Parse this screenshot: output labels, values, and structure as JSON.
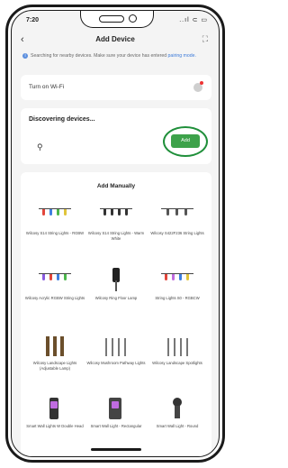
{
  "status_bar": {
    "time": "7:20",
    "signal": "..ıl ⊂ ▭"
  },
  "header": {
    "back_icon": "chevron-left-icon",
    "title": "Add Device",
    "scan_icon": "scan-icon"
  },
  "hint": {
    "text": "Searching for nearby devices. Make sure your device has entered ",
    "link": "pairing mode."
  },
  "wifi": {
    "label": "Turn on Wi-Fi"
  },
  "discovering": {
    "label": "Discovering devices...",
    "add_label": "Add"
  },
  "manual": {
    "heading": "Add Manually",
    "items": [
      {
        "name": "Wilcosy S14 String Lights - RGBW",
        "icon": "string-lights-rgbw"
      },
      {
        "name": "Wilcosy S14 String Lights - Warm White",
        "icon": "string-lights-warm"
      },
      {
        "name": "Wilcosy S422F236 String Lights",
        "icon": "string-lights-small"
      },
      {
        "name": "Wilcosy Acrylic RGBW String Lights",
        "icon": "acrylic-string-lights"
      },
      {
        "name": "Wilcosy Ring Floor Lamp",
        "icon": "floor-lamp"
      },
      {
        "name": "String Lights S0 - RGBCW",
        "icon": "string-lights-rgbcw"
      },
      {
        "name": "Wilcosy Landscape Lights (Adjustable Lamp)",
        "icon": "landscape-lights"
      },
      {
        "name": "Wilcosy Mushroom Pathway Lights",
        "icon": "pathway-lights"
      },
      {
        "name": "Wilcosy Landscape Spotlights",
        "icon": "spotlights"
      },
      {
        "name": "Smart Wall Lights W Double Head",
        "icon": "wall-light-double"
      },
      {
        "name": "Smart Wall Light - Rectangular",
        "icon": "wall-light-rect"
      },
      {
        "name": "Smart Wall Light - Round",
        "icon": "wall-light-round"
      }
    ]
  },
  "colors": {
    "accent": "#3da24a",
    "highlight_ring": "#1f8f3a",
    "link": "#3b7ad9"
  }
}
